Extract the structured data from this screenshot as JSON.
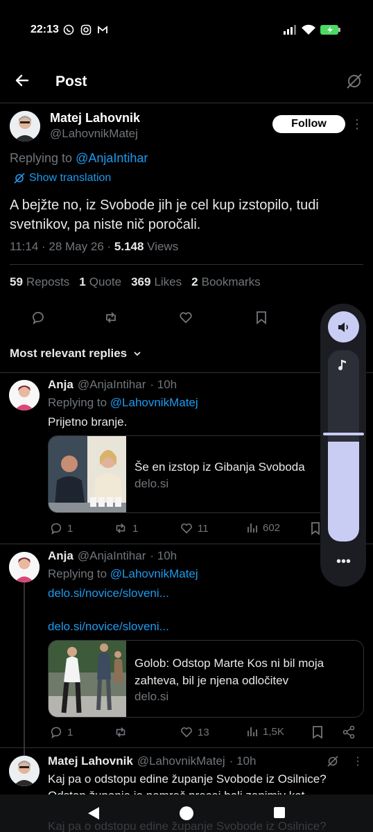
{
  "status_bar": {
    "time": "22:13"
  },
  "header": {
    "title": "Post"
  },
  "main_post": {
    "author_name": "Matej Lahovnik",
    "author_handle": "@LahovnikMatej",
    "follow_label": "Follow",
    "replying_prefix": "Replying to ",
    "replying_handle": "@AnjaIntihar",
    "show_translation": "Show translation",
    "text": "A bejžte no, iz Svobode jih je cel kup izstopilo, tudi svetnikov, pa niste nič poročali.",
    "time": "11:14",
    "date": "28 May 26",
    "views_count": "5.148",
    "views_label": "Views",
    "stats": [
      {
        "count": "59",
        "label": "Reposts"
      },
      {
        "count": "1",
        "label": "Quote"
      },
      {
        "count": "369",
        "label": "Likes"
      },
      {
        "count": "2",
        "label": "Bookmarks"
      }
    ]
  },
  "sort": {
    "label": "Most relevant replies"
  },
  "replies": [
    {
      "name": "Anja",
      "handle": "@AnjaIntihar",
      "age": "· 10h",
      "replying_prefix": "Replying to ",
      "replying_handle": "@LahovnikMatej",
      "text": "Prijetno branje.",
      "card": {
        "title": "Še en izstop iz Gibanja Svoboda",
        "domain": "delo.si"
      },
      "actions": {
        "replies": "1",
        "reposts": "1",
        "likes": "11",
        "views": "602"
      }
    },
    {
      "name": "Anja",
      "handle": "@AnjaIntihar",
      "age": "· 10h",
      "replying_prefix": "Replying to ",
      "replying_handle": "@LahovnikMatej",
      "link1": "delo.si/novice/sloveni...",
      "link2": "delo.si/novice/sloveni...",
      "card": {
        "title": "Golob: Odstop Marte Kos ni bil moja zahteva, bil je njena odločitev",
        "domain": "delo.si"
      },
      "actions": {
        "replies": "1",
        "reposts": "",
        "likes": "13",
        "views": "1,5K"
      }
    },
    {
      "name": "Matej Lahovnik",
      "handle": "@LahovnikMatej",
      "age": "· 10h",
      "text": "Kaj pa o odstopu edine županje Svobode iz Osilnice? Odstop županje je namreč precej bolj zanimiv kot",
      "ghost_text": "Kaj pa o odstopu edine županje Svobode iz Osilnice?"
    }
  ],
  "volume_panel": {
    "level": 0.52
  },
  "colors": {
    "background": "#000000",
    "link": "#1d9bf0",
    "muted": "#71767b",
    "volume_accent": "#c9cdf4"
  }
}
